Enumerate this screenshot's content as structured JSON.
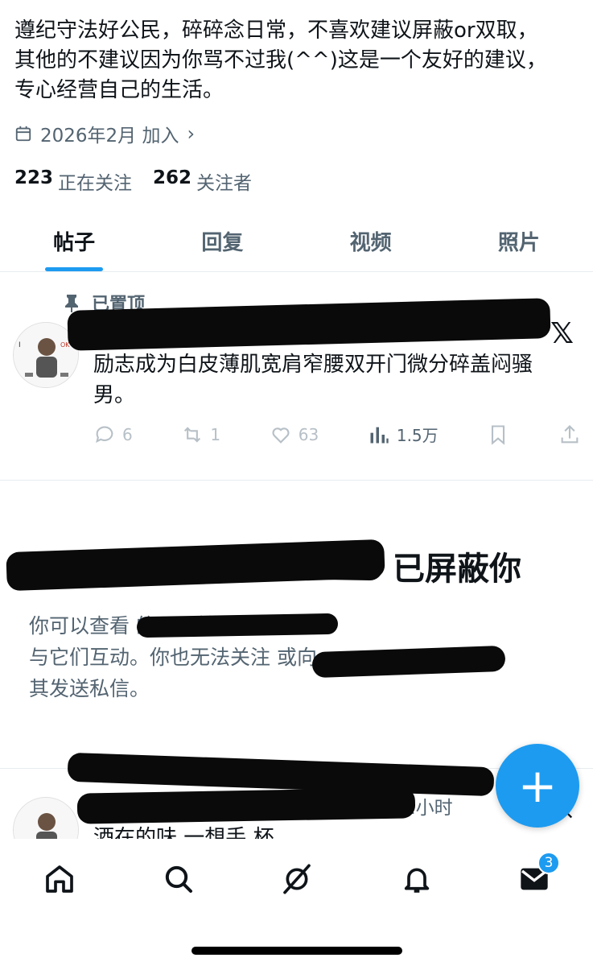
{
  "profile": {
    "bio_lines": [
      "遵纪守法好公民，碎碎念日常，不喜欢建议屏蔽or双取，",
      "其他的不建议因为你骂不过我(^^)这是一个友好的建议，",
      "专心经营自己的生活。"
    ],
    "joined": "2026年2月 加入",
    "following_count": "223",
    "following_label": "正在关注",
    "followers_count": "262",
    "followers_label": "关注者"
  },
  "tabs": [
    {
      "label": "帖子",
      "active": true
    },
    {
      "label": "回复",
      "active": false
    },
    {
      "label": "视频",
      "active": false
    },
    {
      "label": "照片",
      "active": false
    }
  ],
  "pinned_tweet": {
    "pinned_label": "已置顶",
    "text_lines": [
      "励志成为白皮薄肌宽肩窄腰双开门微分碎盖闷骚",
      "男。"
    ],
    "replies": "6",
    "retweets": "1",
    "likes": "63",
    "views": "1.5万"
  },
  "blocked_notice": {
    "title": "已屏蔽你",
    "desc_lines": [
      "你可以查看 的公开帖子，但无法",
      "与它们互动。你也无法关注 或向",
      "其发送私信。"
    ]
  },
  "second_tweet": {
    "time": "2小时",
    "text": "酒在的味 一想手 杯"
  },
  "bottom_nav": {
    "badge_count": "3",
    "icons": [
      "home-icon",
      "search-icon",
      "grok-icon",
      "notifications-icon",
      "messages-icon"
    ]
  },
  "colors": {
    "accent": "#1d9bf0",
    "text_primary": "#0f1419",
    "text_secondary": "#536471"
  }
}
